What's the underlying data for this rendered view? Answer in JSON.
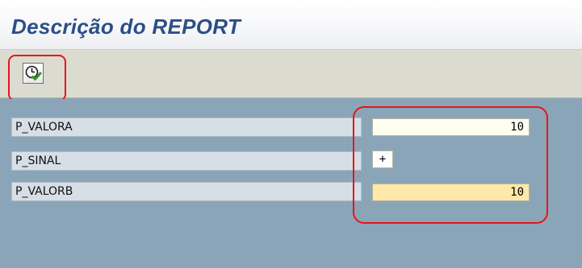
{
  "header": {
    "title": "Descrição do REPORT"
  },
  "toolbar": {
    "execute_icon": "execute-clock-check-icon"
  },
  "parameters": [
    {
      "label": "P_VALORA",
      "value": "10"
    },
    {
      "label": "P_SINAL",
      "value": "+"
    },
    {
      "label": "P_VALORB",
      "value": "10"
    }
  ],
  "colors": {
    "title": "#2c4f86",
    "toolbar_bg": "#dcdbd0",
    "form_bg": "#8ba5b8",
    "highlight": "#e8141c",
    "field_a_bg": "#fffff0",
    "field_c_bg": "#ffe8a8"
  }
}
